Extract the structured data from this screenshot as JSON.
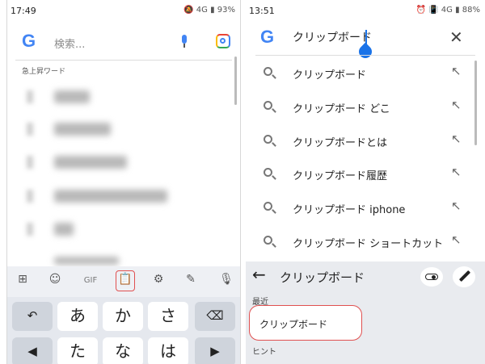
{
  "left": {
    "status": {
      "time": "17:49",
      "icons": "🔕 4G ▮ 93%"
    },
    "search": {
      "placeholder": "検索..."
    },
    "trending_header": "急上昇ワード",
    "toolbar": {
      "gif": "GIF"
    },
    "keys": {
      "row1": [
        "あ",
        "か",
        "さ"
      ],
      "row2": [
        "た",
        "な",
        "は"
      ]
    }
  },
  "right": {
    "status": {
      "time": "13:51",
      "icons": "⏰ 📳 4G ▮ 88%"
    },
    "query": "クリップボード",
    "suggestions": [
      "クリップボード",
      "クリップボード どこ",
      "クリップボードとは",
      "クリップボード履歴",
      "クリップボード iphone",
      "クリップボード ショートカット"
    ],
    "clipboard": {
      "title": "クリップボード",
      "recent_label": "最近",
      "recent_items": [
        "クリップボード"
      ],
      "hint_label": "ヒント"
    }
  },
  "colors": {
    "accent": "#1a73e8",
    "highlight": "#e05050",
    "keyboard_bg": "#e5e8ee"
  }
}
